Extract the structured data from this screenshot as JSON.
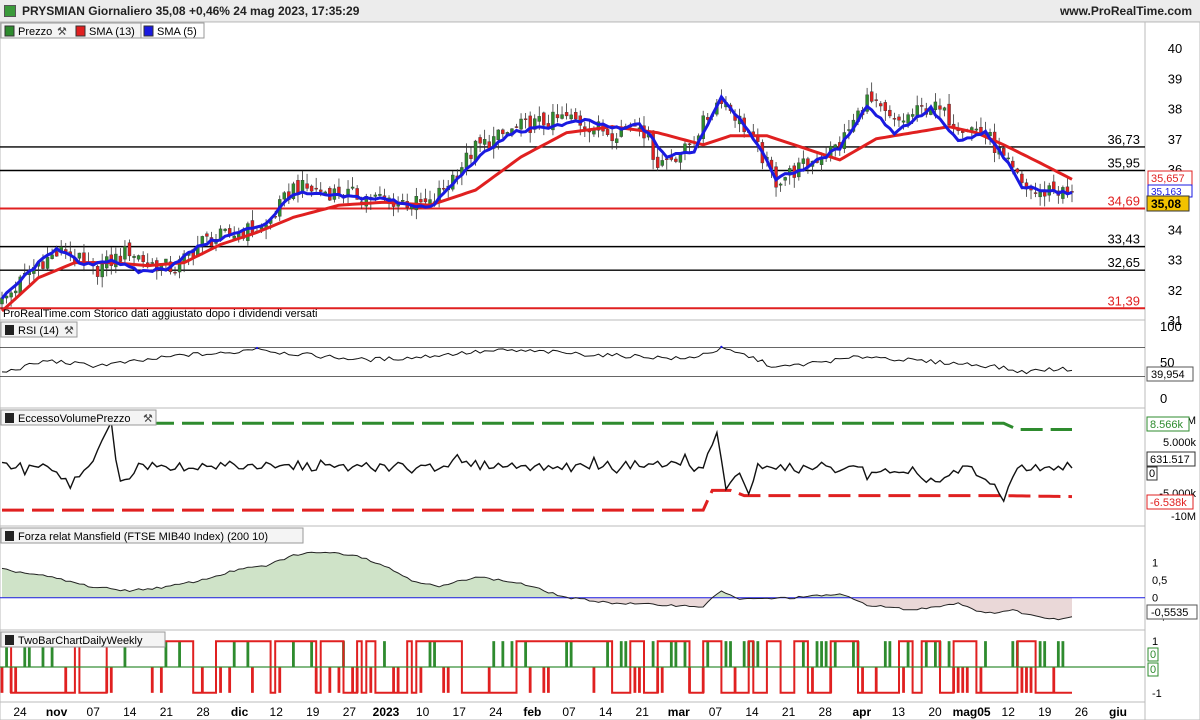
{
  "header": {
    "title": "PRYSMIAN Giornaliero 35,08 +0,46% 24 mag 2023, 17:35:29",
    "site": "www.ProRealTime.com"
  },
  "colors": {
    "up": "#2e8b2e",
    "down": "#e02020",
    "sma13": "#e02020",
    "sma5": "#1a1ae0",
    "hline_black": "#000000",
    "hline_red": "#e02020",
    "mansfield_pos": "#cfe3c8",
    "mansfield_neg": "#ead8d8",
    "last_price_bg": "#f2c200"
  },
  "legend_main": [
    {
      "label": "Prezzo",
      "icon": "candle-icon"
    },
    {
      "label": "SMA (13)",
      "color": "#e02020"
    },
    {
      "label": "SMA (5)",
      "color": "#1a1ae0"
    }
  ],
  "footnote": "ProRealTime.com Storico dati aggiustato dopo i dividendi versati",
  "chart_data": [
    {
      "type": "candlestick",
      "panel": "price",
      "ylim": [
        31.2,
        40.6
      ],
      "y_ticks": [
        "40",
        "39",
        "38",
        "37",
        "36",
        "35",
        "34",
        "33",
        "32",
        "31"
      ],
      "x_labels": [
        "24",
        "nov",
        "07",
        "14",
        "21",
        "28",
        "dic",
        "12",
        "19",
        "27",
        "2023",
        "10",
        "17",
        "24",
        "feb",
        "07",
        "14",
        "21",
        "mar",
        "07",
        "14",
        "21",
        "28",
        "apr",
        "13",
        "20",
        "mag05",
        "12",
        "19",
        "26",
        "giu"
      ],
      "anchors": [
        [
          0,
          31.6
        ],
        [
          8,
          32.9
        ],
        [
          14,
          33.3
        ],
        [
          20,
          32.6
        ],
        [
          28,
          33.3
        ],
        [
          32,
          32.9
        ],
        [
          38,
          32.7
        ],
        [
          44,
          33.6
        ],
        [
          52,
          33.9
        ],
        [
          58,
          34.1
        ],
        [
          64,
          35.4
        ],
        [
          74,
          35.2
        ],
        [
          84,
          35.0
        ],
        [
          94,
          34.8
        ],
        [
          104,
          36.7
        ],
        [
          114,
          37.4
        ],
        [
          124,
          37.7
        ],
        [
          134,
          37.2
        ],
        [
          140,
          37.6
        ],
        [
          144,
          36.2
        ],
        [
          150,
          36.6
        ],
        [
          158,
          38.4
        ],
        [
          164,
          37.2
        ],
        [
          170,
          35.6
        ],
        [
          176,
          36.1
        ],
        [
          184,
          36.8
        ],
        [
          190,
          38.3
        ],
        [
          196,
          37.5
        ],
        [
          204,
          38.1
        ],
        [
          210,
          37.5
        ],
        [
          216,
          37.2
        ],
        [
          220,
          36.3
        ],
        [
          224,
          35.5
        ],
        [
          228,
          35.1
        ],
        [
          230,
          35.4
        ],
        [
          235,
          35.1
        ]
      ],
      "series_sma13": [
        [
          0,
          31.3
        ],
        [
          8,
          32.4
        ],
        [
          16,
          32.9
        ],
        [
          24,
          32.9
        ],
        [
          32,
          32.8
        ],
        [
          40,
          32.9
        ],
        [
          48,
          33.5
        ],
        [
          56,
          33.9
        ],
        [
          64,
          34.4
        ],
        [
          74,
          34.8
        ],
        [
          84,
          34.9
        ],
        [
          94,
          34.8
        ],
        [
          104,
          35.3
        ],
        [
          114,
          36.4
        ],
        [
          124,
          37.2
        ],
        [
          134,
          37.4
        ],
        [
          144,
          37.2
        ],
        [
          154,
          36.8
        ],
        [
          160,
          37.1
        ],
        [
          168,
          37.1
        ],
        [
          174,
          36.8
        ],
        [
          184,
          36.3
        ],
        [
          192,
          37.0
        ],
        [
          200,
          37.2
        ],
        [
          208,
          37.4
        ],
        [
          214,
          37.2
        ],
        [
          220,
          36.8
        ],
        [
          228,
          36.2
        ],
        [
          235,
          35.66
        ]
      ],
      "series_sma5": [
        [
          0,
          31.7
        ],
        [
          6,
          32.6
        ],
        [
          12,
          33.4
        ],
        [
          18,
          32.8
        ],
        [
          24,
          33.0
        ],
        [
          30,
          32.6
        ],
        [
          36,
          32.7
        ],
        [
          44,
          33.5
        ],
        [
          52,
          33.9
        ],
        [
          58,
          34.2
        ],
        [
          64,
          35.2
        ],
        [
          74,
          35.1
        ],
        [
          84,
          35.0
        ],
        [
          94,
          34.7
        ],
        [
          104,
          36.3
        ],
        [
          112,
          37.2
        ],
        [
          120,
          37.4
        ],
        [
          128,
          37.6
        ],
        [
          136,
          37.3
        ],
        [
          140,
          37.5
        ],
        [
          146,
          36.4
        ],
        [
          152,
          36.6
        ],
        [
          158,
          38.4
        ],
        [
          164,
          37.3
        ],
        [
          170,
          35.7
        ],
        [
          176,
          36.0
        ],
        [
          184,
          36.7
        ],
        [
          190,
          38.1
        ],
        [
          196,
          37.2
        ],
        [
          204,
          38.0
        ],
        [
          210,
          36.9
        ],
        [
          216,
          37.2
        ],
        [
          220,
          36.4
        ],
        [
          224,
          35.4
        ],
        [
          230,
          35.3
        ],
        [
          235,
          35.16
        ]
      ],
      "hlines": [
        {
          "value": 36.73,
          "label": "36,73",
          "color": "black"
        },
        {
          "value": 35.95,
          "label": "35,95",
          "color": "black"
        },
        {
          "value": 34.69,
          "label": "34,69",
          "color": "red"
        },
        {
          "value": 33.43,
          "label": "33,43",
          "color": "black"
        },
        {
          "value": 32.65,
          "label": "32,65",
          "color": "black"
        },
        {
          "value": 31.39,
          "label": "31,39",
          "color": "red"
        }
      ],
      "last_values": {
        "sma13": "35,657",
        "sma5": "35,163",
        "price": "35,08"
      }
    },
    {
      "type": "line",
      "panel": "rsi",
      "name": "RSI (14)",
      "ylim": [
        0,
        100
      ],
      "y_ticks": [
        "100",
        "50",
        "0"
      ],
      "hlines": [
        70,
        30
      ],
      "anchors": [
        [
          0,
          35
        ],
        [
          10,
          52
        ],
        [
          20,
          45
        ],
        [
          30,
          51
        ],
        [
          40,
          60
        ],
        [
          50,
          62
        ],
        [
          56,
          70
        ],
        [
          60,
          64
        ],
        [
          70,
          58
        ],
        [
          80,
          53
        ],
        [
          90,
          56
        ],
        [
          100,
          62
        ],
        [
          110,
          66
        ],
        [
          120,
          64
        ],
        [
          130,
          60
        ],
        [
          140,
          58
        ],
        [
          150,
          54
        ],
        [
          158,
          68
        ],
        [
          164,
          58
        ],
        [
          170,
          42
        ],
        [
          180,
          50
        ],
        [
          190,
          58
        ],
        [
          200,
          52
        ],
        [
          210,
          48
        ],
        [
          218,
          44
        ],
        [
          224,
          36
        ],
        [
          230,
          40
        ],
        [
          235,
          39.95
        ]
      ],
      "last_value": "39,954"
    },
    {
      "type": "line",
      "panel": "volume-excess",
      "name": "EccessoVolumePrezzo",
      "y_ticks": [
        "10M",
        "5.000k",
        "0",
        "-5.000k",
        "-10M"
      ],
      "upper_band": [
        [
          0,
          8.6
        ],
        [
          220,
          8.6
        ],
        [
          223,
          7.4
        ],
        [
          235,
          7.4
        ]
      ],
      "lower_band": [
        [
          0,
          -8.1
        ],
        [
          154,
          -8.1
        ],
        [
          156,
          -4.3
        ],
        [
          160,
          -4.3
        ],
        [
          163,
          -5.3
        ],
        [
          218,
          -5.3
        ],
        [
          235,
          -5.5
        ]
      ],
      "anchors": [
        [
          0,
          0.4
        ],
        [
          10,
          0.1
        ],
        [
          15,
          -3.1
        ],
        [
          20,
          0.6
        ],
        [
          24,
          9.0
        ],
        [
          26,
          -3.1
        ],
        [
          30,
          0.4
        ],
        [
          60,
          0.3
        ],
        [
          80,
          0.0
        ],
        [
          100,
          0.8
        ],
        [
          120,
          0.2
        ],
        [
          150,
          0.9
        ],
        [
          154,
          -0.6
        ],
        [
          157,
          6.8
        ],
        [
          159,
          -4.4
        ],
        [
          162,
          -1.0
        ],
        [
          164,
          -4.4
        ],
        [
          166,
          0.3
        ],
        [
          190,
          -0.3
        ],
        [
          206,
          -2.5
        ],
        [
          212,
          0.2
        ],
        [
          220,
          -4.9
        ],
        [
          224,
          0.5
        ],
        [
          230,
          0.0
        ],
        [
          235,
          0.6
        ]
      ],
      "last_values": {
        "upper": "8.566k",
        "main": "631.517",
        "zero": "0",
        "lower": "-6.538k"
      }
    },
    {
      "type": "area",
      "panel": "mansfield",
      "name": "Forza relat Mansfield (FTSE MIB40 Index) (200 10)",
      "ylim": [
        -0.8,
        1.8
      ],
      "y_ticks": [
        "1",
        "0,5",
        "0",
        "-0,5"
      ],
      "anchors": [
        [
          0,
          0.8
        ],
        [
          10,
          0.6
        ],
        [
          20,
          0.3
        ],
        [
          28,
          0.2
        ],
        [
          36,
          0.3
        ],
        [
          44,
          0.5
        ],
        [
          52,
          0.8
        ],
        [
          58,
          0.9
        ],
        [
          64,
          1.2
        ],
        [
          70,
          1.3
        ],
        [
          78,
          1.2
        ],
        [
          84,
          0.9
        ],
        [
          90,
          0.5
        ],
        [
          96,
          0.3
        ],
        [
          104,
          0.6
        ],
        [
          114,
          0.4
        ],
        [
          124,
          0.0
        ],
        [
          134,
          -0.15
        ],
        [
          144,
          -0.2
        ],
        [
          154,
          -0.25
        ],
        [
          158,
          0.2
        ],
        [
          162,
          -0.05
        ],
        [
          174,
          0.0
        ],
        [
          184,
          0.1
        ],
        [
          190,
          -0.2
        ],
        [
          200,
          -0.35
        ],
        [
          210,
          -0.15
        ],
        [
          216,
          -0.45
        ],
        [
          222,
          -0.35
        ],
        [
          226,
          -0.5
        ],
        [
          232,
          -0.6
        ],
        [
          235,
          -0.55
        ]
      ],
      "last_value": "-0,5535"
    },
    {
      "type": "step",
      "panel": "twobar",
      "name": "TwoBarChartDailyWeekly",
      "y_ticks": [
        "1",
        "0",
        "-1"
      ],
      "last_values": [
        "0",
        "0"
      ]
    }
  ]
}
